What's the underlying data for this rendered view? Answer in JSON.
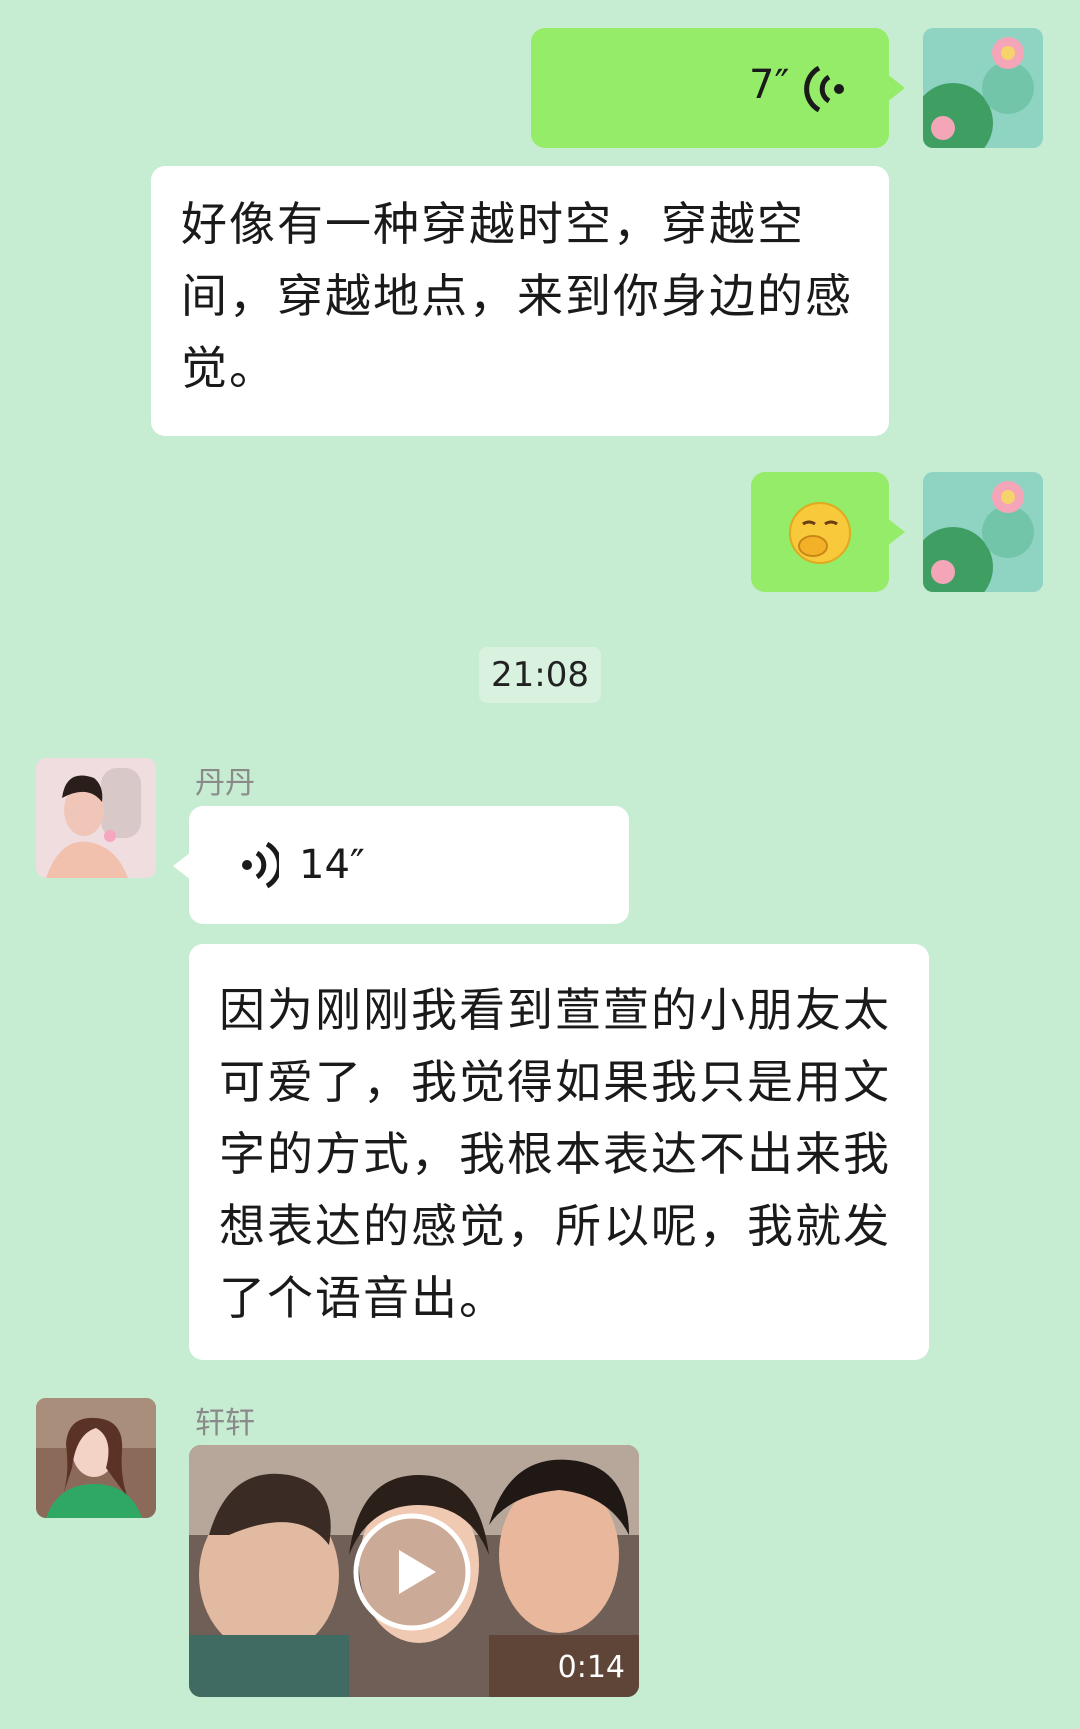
{
  "messages": {
    "voice_out": {
      "duration": "7″",
      "icon": "voice-wave-icon"
    },
    "text_out": {
      "text": "好像有一种穿越时空，穿越空间，穿越地点，来到你身边的感觉。"
    },
    "emoji_out": {
      "icon": "hand-over-mouth-emoji"
    },
    "timestamp": "21:08",
    "voice_in": {
      "sender": "丹丹",
      "duration": "14″",
      "icon": "voice-wave-icon"
    },
    "text_in": {
      "text": "因为刚刚我看到萱萱的小朋友太可爱了，我觉得如果我只是用文字的方式，我根本表达不出来我想表达的感觉，所以呢，我就发了个语音出。"
    },
    "video_in": {
      "sender": "轩轩",
      "duration": "0:14",
      "icon": "play-icon"
    }
  },
  "colors": {
    "background": "#c6ecd1",
    "bubble_out": "#95ec69",
    "bubble_in": "#ffffff"
  }
}
